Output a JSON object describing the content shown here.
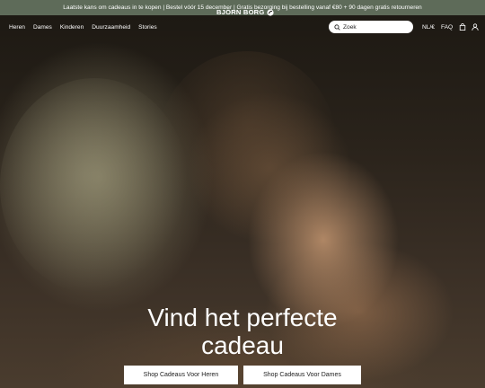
{
  "announcement": {
    "text": "Laatste kans om cadeaus in te kopen | Bestel vóór 15 december | Gratis bezorging bij bestelling vanaf €80 + 90 dagen gratis retourneren"
  },
  "nav": {
    "items": [
      {
        "label": "Heren"
      },
      {
        "label": "Dames"
      },
      {
        "label": "Kinderen"
      },
      {
        "label": "Duurzaamheid"
      },
      {
        "label": "Stories"
      }
    ],
    "logo_text": "BJÖRN BORG",
    "search": {
      "placeholder": "Zoek",
      "icon": "search-icon"
    },
    "locale": "NL/€",
    "faq": "FAQ",
    "icons": [
      "bag-icon",
      "user-icon"
    ]
  },
  "hero": {
    "headline_line1": "Vind het perfecte",
    "headline_line2": "cadeau",
    "cta_men": "Shop Cadeaus Voor Heren",
    "cta_women": "Shop Cadeaus Voor Dames"
  },
  "colors": {
    "announcement_bg": "#5e6b59",
    "text_light": "#ffffff",
    "button_bg": "#ffffff",
    "button_text": "#222222"
  }
}
